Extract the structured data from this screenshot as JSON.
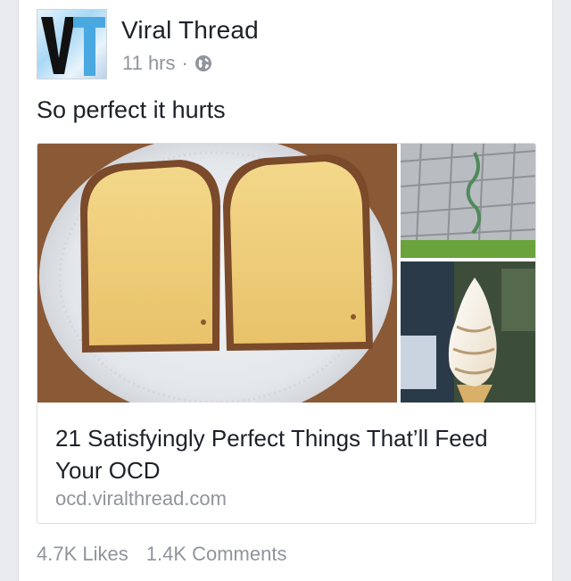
{
  "post": {
    "page_name": "Viral Thread",
    "time": "11 hrs",
    "separator": "·",
    "privacy_icon": "globe-icon",
    "text": "So perfect it hurts",
    "avatar_letters": "VT"
  },
  "link": {
    "title": "21 Satisfyingly Perfect Things That’ll Feed Your OCD",
    "domain": "ocd.viralthread.com",
    "images": [
      "cheese-sandwiches-photo",
      "paving-stones-photo",
      "soft-serve-cone-photo"
    ]
  },
  "stats": {
    "likes": "4.7K Likes",
    "comments": "1.4K Comments"
  },
  "colors": {
    "background": "#e9ebee",
    "card": "#ffffff",
    "text": "#1d2129",
    "muted": "#90949c"
  }
}
